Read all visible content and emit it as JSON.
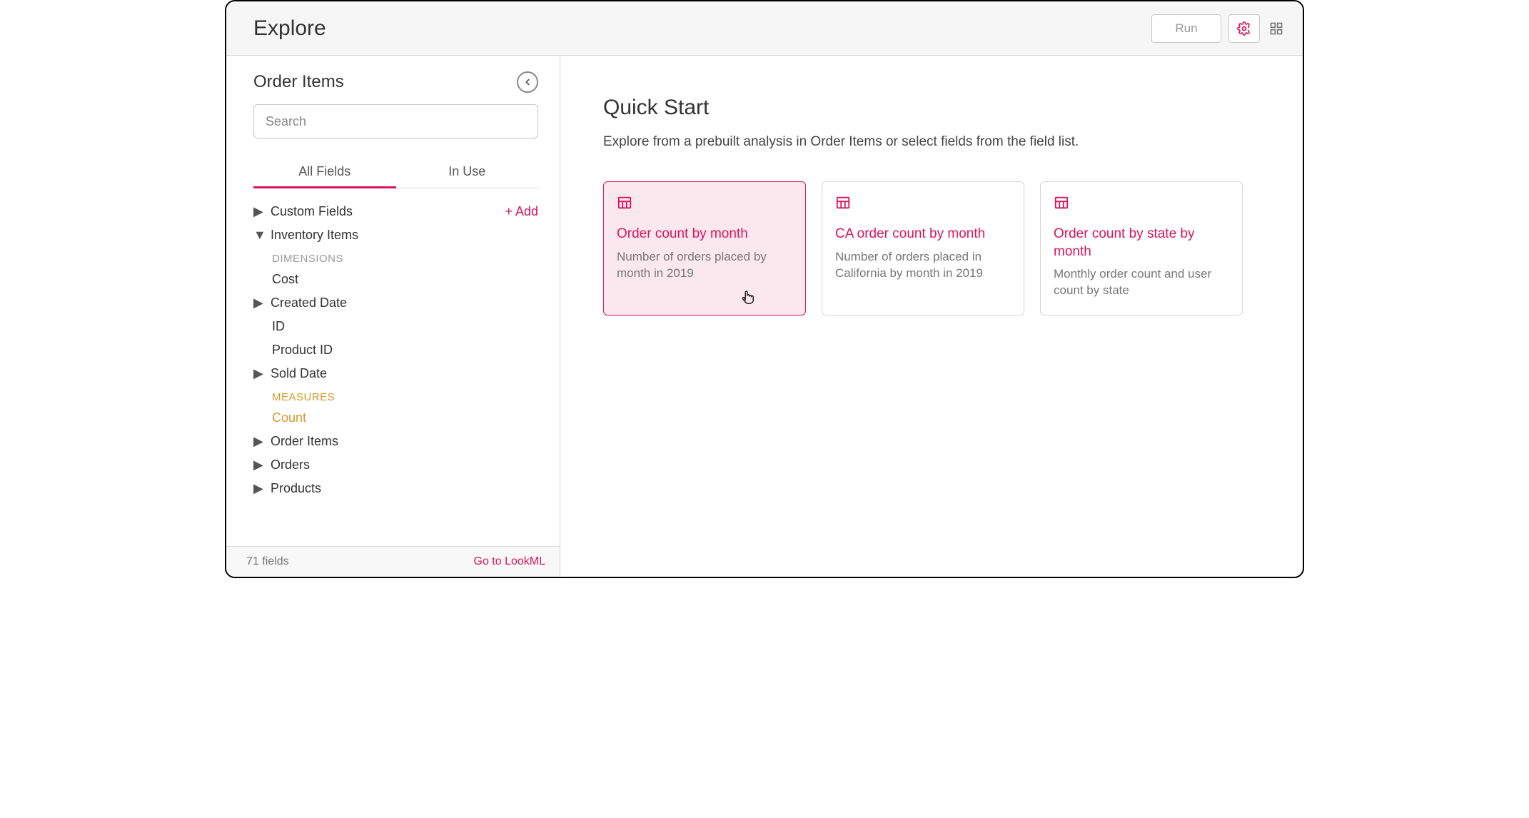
{
  "topbar": {
    "title": "Explore",
    "run_label": "Run"
  },
  "sidebar": {
    "title": "Order Items",
    "search_placeholder": "Search",
    "tabs": {
      "all": "All Fields",
      "in_use": "In Use"
    },
    "custom_fields_label": "Custom Fields",
    "add_label": "+  Add",
    "inventory_items_label": "Inventory Items",
    "dimensions_heading": "DIMENSIONS",
    "measures_heading": "MEASURES",
    "dimensions": {
      "cost": "Cost",
      "created_date": "Created Date",
      "id": "ID",
      "product_id": "Product ID",
      "sold_date": "Sold Date"
    },
    "measures": {
      "count": "Count"
    },
    "groups": {
      "order_items": "Order Items",
      "orders": "Orders",
      "products": "Products"
    },
    "footer": {
      "count_text": "71 fields",
      "lookml_label": "Go to LookML"
    }
  },
  "main": {
    "heading": "Quick Start",
    "sub": "Explore from a prebuilt analysis in Order Items or select fields from the field list.",
    "cards": [
      {
        "title": "Order count by month",
        "desc": "Number of orders placed by month in 2019"
      },
      {
        "title": "CA order count by month",
        "desc": "Number of orders placed in California by month in 2019"
      },
      {
        "title": "Order count by state by month",
        "desc": "Monthly order count and user count by state"
      }
    ]
  }
}
